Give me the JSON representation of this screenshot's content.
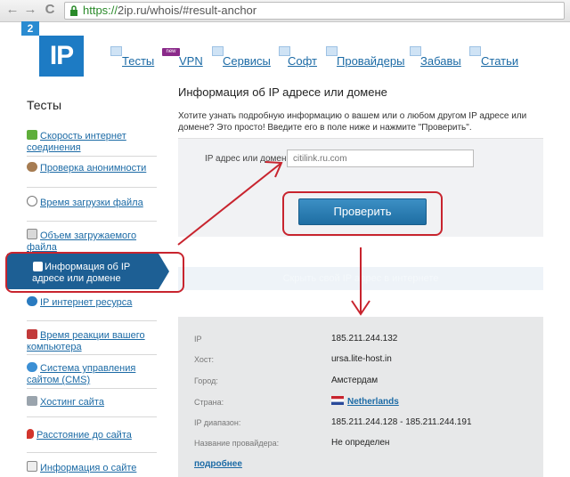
{
  "browser": {
    "url_protocol": "https://",
    "url_rest": "2ip.ru/whois/#result-anchor",
    "back_glyph": "←",
    "forward_glyph": "→",
    "reload_glyph": "C"
  },
  "logo": {
    "small_text": "2",
    "main_text": "IP"
  },
  "top_menu": {
    "new_badge": "new",
    "items": [
      {
        "label": "Тесты",
        "icon": "menu-icon"
      },
      {
        "label": "VPN",
        "icon": "menu-icon"
      },
      {
        "label": "Сервисы",
        "icon": "menu-icon"
      },
      {
        "label": "Софт",
        "icon": "menu-icon"
      },
      {
        "label": "Провайдеры",
        "icon": "menu-icon"
      },
      {
        "label": "Забавы",
        "icon": "menu-icon"
      },
      {
        "label": "Статьи",
        "icon": "menu-icon"
      }
    ]
  },
  "sidebar": {
    "title": "Тесты",
    "items": [
      {
        "label": "Скорость интернет соединения",
        "icon": "speed-arrow-icon"
      },
      {
        "label": "Проверка анонимности",
        "icon": "person-icon"
      },
      {
        "label": "Время загрузки файла",
        "icon": "clock-icon"
      },
      {
        "label": "Объем загружаемого файла",
        "icon": "file-icon"
      },
      {
        "label": "Информация об IP адресе или домене",
        "icon": "ip-icon"
      },
      {
        "label": "IP интернет ресурса",
        "icon": "ip-globe-icon"
      },
      {
        "label": "Время реакции вашего компьютера",
        "icon": "computer-icon"
      },
      {
        "label": "Система управления сайтом (CMS)",
        "icon": "cms-icon"
      },
      {
        "label": "Хостинг сайта",
        "icon": "hosting-icon"
      },
      {
        "label": "Расстояние до сайта",
        "icon": "map-pin-icon"
      },
      {
        "label": "Информация о сайте",
        "icon": "document-icon"
      }
    ]
  },
  "main": {
    "title": "Информация об IP адресе или домене",
    "description": "Хотите узнать подробную информацию о вашем или о любом другом IP адресе или домене? Это просто! Введите его в поле ниже и нажмите \"Проверить\".",
    "input_label": "IP адрес или домен:",
    "input_placeholder": "citilink.ru.com",
    "button_label": "Проверить",
    "banner_text": "Скрыть свой IP адрес в интернете"
  },
  "results": {
    "rows": [
      {
        "label": "IP",
        "value": "185.211.244.132"
      },
      {
        "label": "Хост:",
        "value": "ursa.lite-host.in"
      },
      {
        "label": "Город:",
        "value": "Амстердам"
      },
      {
        "label": "Страна:",
        "value": "Netherlands"
      },
      {
        "label": "IP диапазон:",
        "value": "185.211.244.128 - 185.211.244.191"
      },
      {
        "label": "Название провайдера:",
        "value": "Не определен"
      }
    ],
    "more_link": "подробнее"
  },
  "colors": {
    "accent": "#1d7bc4",
    "link": "#1b6aa5",
    "active_sidebar": "#1d5f94",
    "annotation": "#c8242e"
  }
}
